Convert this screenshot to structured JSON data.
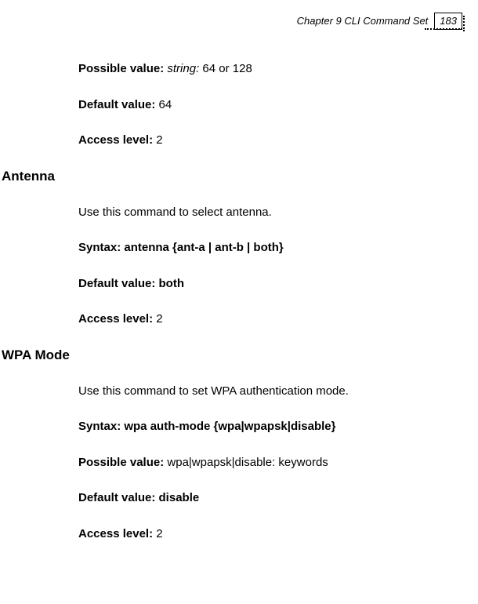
{
  "header": {
    "chapter_title": "Chapter 9 CLI Command Set",
    "page_number": "183"
  },
  "blocks": {
    "possible_value_1": {
      "label": "Possible value: ",
      "value_italic": "string: ",
      "value_plain": "64 or 128"
    },
    "default_value_1": {
      "label": "Default value: ",
      "value": "64"
    },
    "access_level_1": {
      "label": "Access level: ",
      "value": "2"
    },
    "antenna_heading": "Antenna",
    "antenna_desc": "Use this command to select antenna.",
    "antenna_syntax": "Syntax: antenna {ant-a | ant-b | both}",
    "antenna_default": "Default value: both",
    "antenna_access": {
      "label": "Access level: ",
      "value": "2"
    },
    "wpa_heading": "WPA Mode",
    "wpa_desc": "Use this command to set WPA authentication mode.",
    "wpa_syntax": "Syntax: wpa auth-mode  {wpa|wpapsk|disable}",
    "wpa_possible": {
      "label": "Possible value: ",
      "value": "wpa|wpapsk|disable: keywords"
    },
    "wpa_default": "Default value: disable",
    "wpa_access": {
      "label": "Access level: ",
      "value": "2"
    }
  }
}
